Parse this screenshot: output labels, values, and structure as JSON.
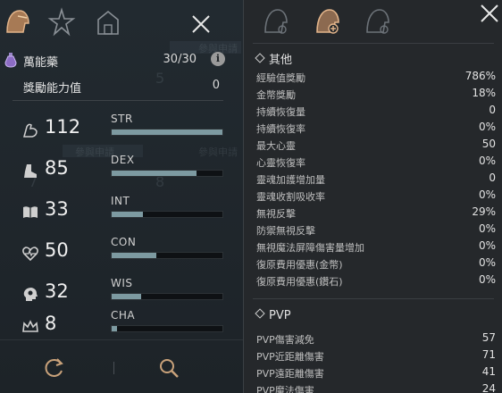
{
  "left_panel": {
    "ghost_text": [
      "參與申請",
      "5",
      "參與申請",
      "參與申請",
      "7",
      "8"
    ],
    "potion": {
      "label": "萬能藥",
      "count": "30/30",
      "info": "i"
    },
    "bonus": {
      "label": "獎勵能力值",
      "value": "0"
    },
    "stats": [
      {
        "name": "STR",
        "value": "112",
        "fill_pct": 100,
        "icon": "arm-icon"
      },
      {
        "name": "DEX",
        "value": "85",
        "fill_pct": 77,
        "icon": "boot-icon"
      },
      {
        "name": "INT",
        "value": "33",
        "fill_pct": 28,
        "icon": "book-icon"
      },
      {
        "name": "CON",
        "value": "50",
        "fill_pct": 40,
        "icon": "heart-icon"
      },
      {
        "name": "WIS",
        "value": "32",
        "fill_pct": 27,
        "icon": "head-icon"
      },
      {
        "name": "CHA",
        "value": "8",
        "fill_pct": 5,
        "icon": "crown-icon"
      }
    ]
  },
  "right_panel": {
    "other": {
      "header": "其他",
      "rows": [
        {
          "k": "經驗值獎勵",
          "v": "786%"
        },
        {
          "k": "金幣獎勵",
          "v": "18%"
        },
        {
          "k": "持續恢復量",
          "v": "0"
        },
        {
          "k": "持續恢復率",
          "v": "0%"
        },
        {
          "k": "最大心靈",
          "v": "50"
        },
        {
          "k": "心靈恢復率",
          "v": "0%"
        },
        {
          "k": "靈魂加護增加量",
          "v": "0"
        },
        {
          "k": "靈魂收割吸收率",
          "v": "0%"
        },
        {
          "k": "無視反擊",
          "v": "29%"
        },
        {
          "k": "防禦無視反擊",
          "v": "0%"
        },
        {
          "k": "無視魔法屏障傷害量增加",
          "v": "0%"
        },
        {
          "k": "復原費用優惠(金幣)",
          "v": "0%"
        },
        {
          "k": "復原費用優惠(鑽石)",
          "v": "0%"
        }
      ]
    },
    "pvp": {
      "header": "PVP",
      "rows": [
        {
          "k": "PVP傷害減免",
          "v": "57"
        },
        {
          "k": "PVP近距離傷害",
          "v": "71"
        },
        {
          "k": "PVP遠距離傷害",
          "v": "41"
        },
        {
          "k": "PVP魔法傷害",
          "v": "24"
        }
      ]
    }
  },
  "colors": {
    "bar_fill": "#7d9aa1",
    "accent_gold": "#c9a27a"
  }
}
